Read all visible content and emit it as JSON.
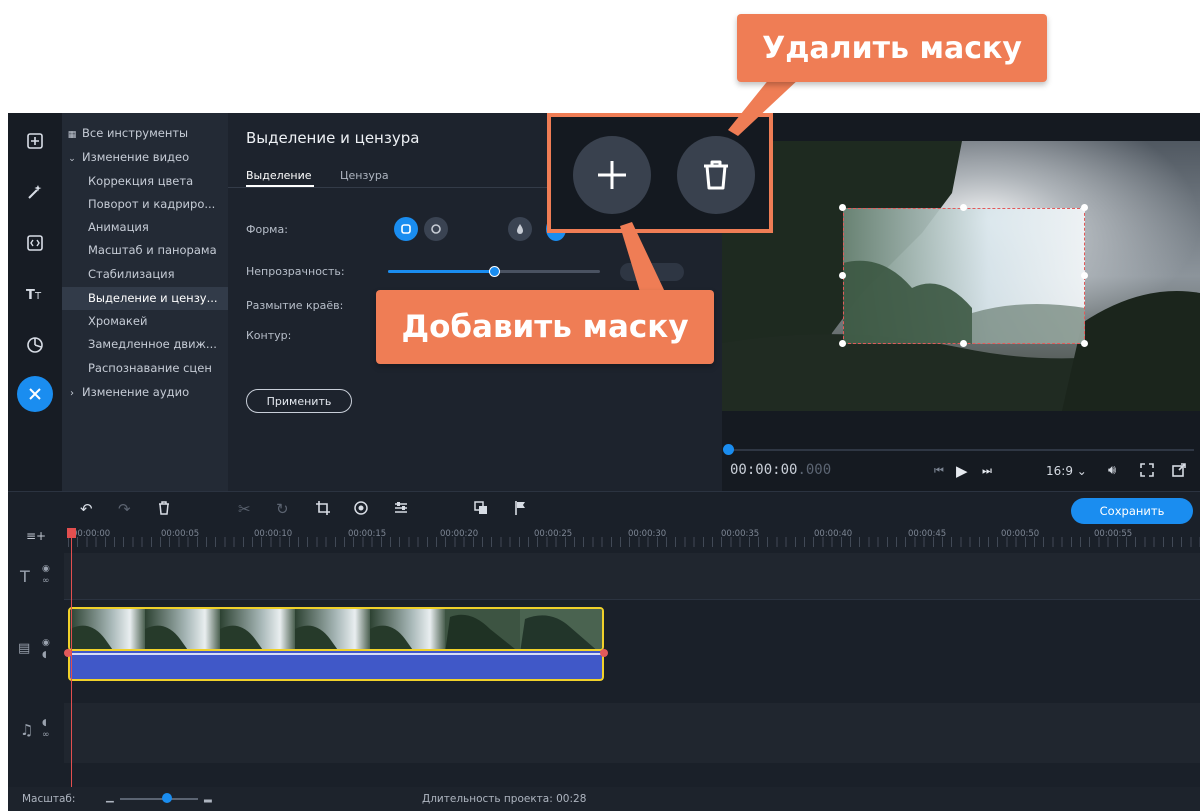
{
  "callouts": {
    "delete_mask": "Удалить маску",
    "add_mask": "Добавить маску"
  },
  "sidebar": {
    "icons": [
      "import-icon",
      "magic-wand-icon",
      "transitions-icon",
      "titles-icon",
      "stickers-icon",
      "tools-icon"
    ],
    "active_icon": "tools-icon"
  },
  "tools": {
    "all_tools": "Все инструменты",
    "video_group": "Изменение видео",
    "items": [
      "Коррекция цвета",
      "Поворот и кадриро...",
      "Анимация",
      "Масштаб и панорама",
      "Стабилизация",
      "Выделение и цензу...",
      "Хромакей",
      "Замедленное движ...",
      "Распознавание сцен"
    ],
    "selected_index": 5,
    "audio_group": "Изменение аудио"
  },
  "settings": {
    "title": "Выделение и цензура",
    "tabs": [
      "Выделение",
      "Цензура"
    ],
    "active_tab": 0,
    "shape_label": "Форма:",
    "opacity_label": "Непрозрачность:",
    "opacity_level": 0.5,
    "blur_label": "Размытие краёв:",
    "outline_label": "Контур:",
    "apply_button": "Применить"
  },
  "mask_buttons": {
    "add_icon": "plus-icon",
    "delete_icon": "trash-icon"
  },
  "player": {
    "timecode_main": "00:00:00",
    "timecode_ms": ".000",
    "aspect": "16:9 ⌄"
  },
  "timeline": {
    "save_button": "Сохранить",
    "ticks": [
      "00:00:00",
      "00:00:05",
      "00:00:10",
      "00:00:15",
      "00:00:20",
      "00:00:25",
      "00:00:30",
      "00:00:35",
      "00:00:40",
      "00:00:45",
      "00:00:50",
      "00:00:55"
    ],
    "scale_label": "Масштаб:",
    "duration_label": "Длительность проекта:",
    "duration_value": "00:28"
  },
  "colors": {
    "accent": "#1a8df0",
    "callout": "#ef7d55",
    "clip_border": "#f0d12a",
    "audio_track": "#4058c8"
  }
}
